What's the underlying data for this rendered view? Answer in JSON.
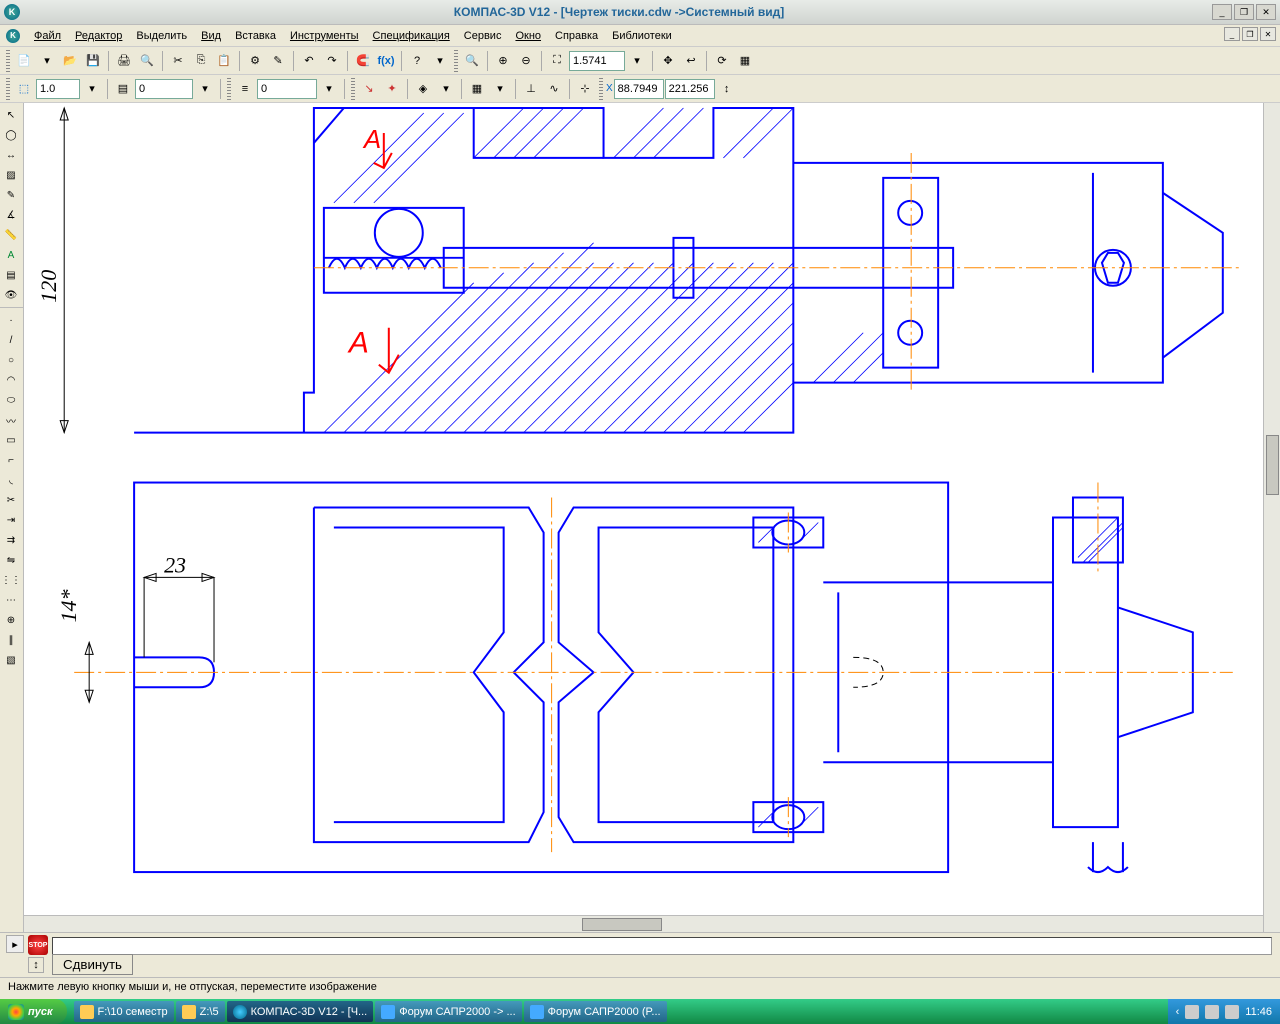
{
  "title": "КОМПАС-3D V12 - [Чертеж тиски.cdw ->Системный вид]",
  "menu": [
    "Файл",
    "Редактор",
    "Выделить",
    "Вид",
    "Вставка",
    "Инструменты",
    "Спецификация",
    "Сервис",
    "Окно",
    "Справка",
    "Библиотеки"
  ],
  "toolbar1": {
    "zoom": "1.5741"
  },
  "toolbar2": {
    "v1": "1.0",
    "v2": "0",
    "v3": "0",
    "coordX": "88.7949",
    "coordY": "221.256"
  },
  "dims": {
    "d1": "120",
    "d2": "14*",
    "d3": "23"
  },
  "redmark": "А",
  "cmd_button": "Сдвинуть",
  "status": "Нажмите левую кнопку мыши и, не отпуская, переместите изображение",
  "taskbar": {
    "start": "пуск",
    "tasks": [
      "F:\\10 семестр",
      "Z:\\5",
      "КОМПАС-3D V12 - [Ч...",
      "Форум САПР2000 -> ...",
      "Форум САПР2000 (P..."
    ],
    "time": "11:46"
  }
}
